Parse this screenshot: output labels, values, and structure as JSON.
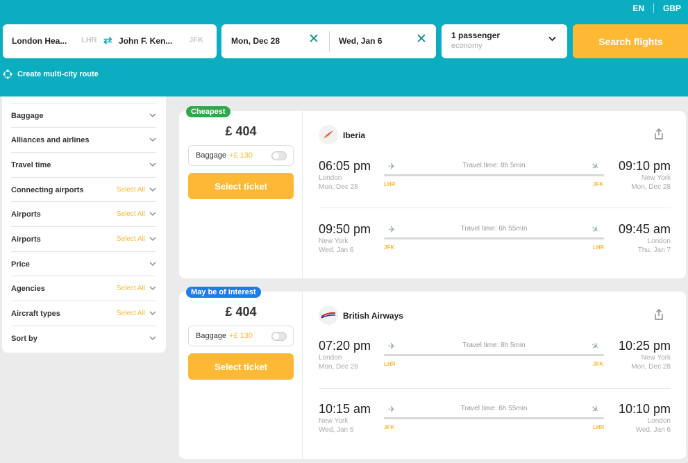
{
  "topnav": {
    "lang": "EN",
    "currency": "GBP"
  },
  "search": {
    "origin": "London Hea...",
    "origin_code": "LHR",
    "destination": "John F. Ken...",
    "destination_code": "JFK",
    "depart_date": "Mon, Dec 28",
    "return_date": "Wed, Jan 6",
    "passengers": "1 passenger",
    "cabin": "economy",
    "button": "Search flights",
    "multi_city": "Create multi-city route"
  },
  "filters": [
    {
      "label": "Baggage",
      "select_all": ""
    },
    {
      "label": "Alliances and airlines",
      "select_all": ""
    },
    {
      "label": "Travel time",
      "select_all": ""
    },
    {
      "label": "Connecting airports",
      "select_all": "Select All"
    },
    {
      "label": "Airports",
      "select_all": "Select All"
    },
    {
      "label": "Airports",
      "select_all": "Select All"
    },
    {
      "label": "Price",
      "select_all": ""
    },
    {
      "label": "Agencies",
      "select_all": "Select All"
    },
    {
      "label": "Aircraft types",
      "select_all": "Select All"
    },
    {
      "label": "Sort by",
      "select_all": ""
    }
  ],
  "results": [
    {
      "badge": "Cheapest",
      "badge_color": "#2ea84a",
      "price": "£ 404",
      "baggage_label": "Baggage",
      "baggage_extra": "+£ 130",
      "select_label": "Select ticket",
      "airline": "Iberia",
      "legs": [
        {
          "dep_time": "06:05 pm",
          "dep_city": "London",
          "dep_date": "Mon, Dec 28",
          "travel_time": "Travel time: 8h 5min",
          "from_code": "LHR",
          "to_code": "JFK",
          "arr_time": "09:10 pm",
          "arr_city": "New York",
          "arr_date": "Mon, Dec 28"
        },
        {
          "dep_time": "09:50 pm",
          "dep_city": "New York",
          "dep_date": "Wed, Jan 6",
          "travel_time": "Travel time: 6h 55min",
          "from_code": "JFK",
          "to_code": "LHR",
          "arr_time": "09:45 am",
          "arr_city": "London",
          "arr_date": "Thu, Jan 7"
        }
      ]
    },
    {
      "badge": "May be of interest",
      "badge_color": "#1e7be8",
      "price": "£ 404",
      "baggage_label": "Baggage",
      "baggage_extra": "+£ 130",
      "select_label": "Select ticket",
      "airline": "British Airways",
      "legs": [
        {
          "dep_time": "07:20 pm",
          "dep_city": "London",
          "dep_date": "Mon, Dec 28",
          "travel_time": "Travel time: 8h 5min",
          "from_code": "LHR",
          "to_code": "JFK",
          "arr_time": "10:25 pm",
          "arr_city": "New York",
          "arr_date": "Mon, Dec 28"
        },
        {
          "dep_time": "10:15 am",
          "dep_city": "New York",
          "dep_date": "Wed, Jan 6",
          "travel_time": "Travel time: 6h 55min",
          "from_code": "JFK",
          "to_code": "LHR",
          "arr_time": "10:10 pm",
          "arr_city": "London",
          "arr_date": "Wed, Jan 6"
        }
      ]
    }
  ],
  "colors": {
    "header": "#0aaec0",
    "accent": "#fdb933",
    "background": "#ebebeb"
  }
}
